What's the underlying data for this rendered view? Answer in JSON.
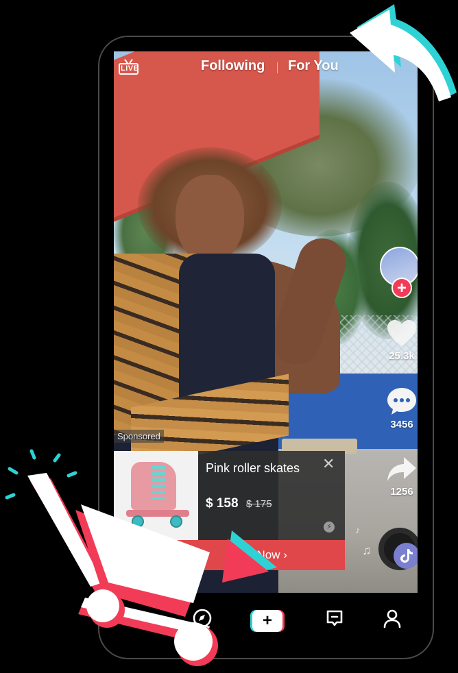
{
  "app": {
    "accent_red": "#f23c57",
    "accent_cyan": "#2fd2d4"
  },
  "top_nav": {
    "live_label": "LIVE",
    "tabs": [
      {
        "label": "Following",
        "active": false
      },
      {
        "label": "For You",
        "active": true
      }
    ]
  },
  "right_rail": {
    "follow_icon": "plus-icon",
    "likes_count": "25.3k",
    "comments_count": "3456",
    "shares_count": "1256"
  },
  "ad": {
    "sponsored_label": "Sponsored",
    "product_title": "Pink roller skates",
    "price": "$ 158",
    "old_price": "$ 175",
    "close_label": "✕",
    "cta_label": "Shop Now ›"
  },
  "bottom_nav": {
    "items": [
      {
        "name": "discover",
        "icon": "compass-icon"
      },
      {
        "name": "create",
        "icon": "plus-icon",
        "label": "+"
      },
      {
        "name": "inbox",
        "icon": "inbox-icon"
      },
      {
        "name": "profile",
        "icon": "person-icon"
      }
    ]
  }
}
